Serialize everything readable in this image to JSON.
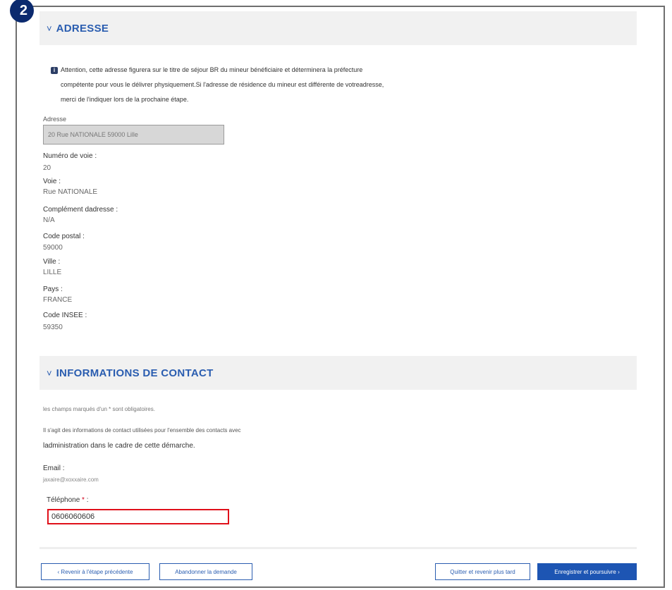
{
  "step_badge": "2",
  "adresse": {
    "title": "ADRESSE",
    "warning_lines": [
      "Attention, cette adresse figurera sur le titre de séjour BR du mineur bénéficiaire et déterminera la préfecture",
      "compétente pour vous le délivrer physiquement.Si l'adresse de résidence du mineur est différente de votreadresse,",
      "merci de l'indiquer lors de la prochaine étape."
    ],
    "field_label": "Adresse",
    "field_value": "20 Rue NATIONALE 59000 Lille",
    "details": [
      {
        "label": "Numéro de voie :",
        "value": "20"
      },
      {
        "label": "Voie :",
        "value": "Rue NATIONALE"
      },
      {
        "label": "Complément dadresse :",
        "value": "N/A"
      },
      {
        "label": "Code postal :",
        "value": "59000"
      },
      {
        "label": "Ville :",
        "value": "LILLE"
      },
      {
        "label": "Pays :",
        "value": "FRANCE"
      },
      {
        "label": "Code INSEE :",
        "value": "59350"
      }
    ]
  },
  "contact": {
    "title": "INFORMATIONS DE CONTACT",
    "required_note": "les champs marqués d'un * sont obligatoires.",
    "intro_line1": "Il s'agit des informations de contact utilisées pour l'ensemble des contacts avec",
    "intro_line2": "ladministration dans le cadre de cette démarche.",
    "email_label": "Email :",
    "email_value": "jaxaire@xoxxaire.com",
    "phone_label": "Téléphone",
    "phone_required": "*",
    "phone_colon": " :",
    "phone_value": "0606060606"
  },
  "buttons": {
    "back": "‹ Revenir à l'étape précédente",
    "abandon": "Abandonner la demande",
    "quit": "Quitter et revenir plus tard",
    "save": "Enregistrer et poursuivre ›"
  }
}
